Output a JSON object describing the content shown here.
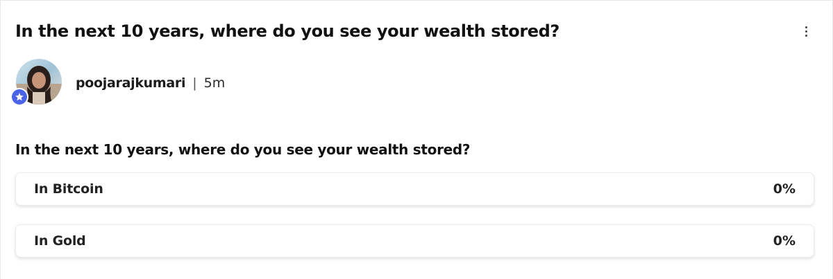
{
  "post": {
    "title": "In the next 10 years, where do you see your wealth stored?",
    "more_icon": "more-vertical-icon"
  },
  "author": {
    "username": "poojarajkumari",
    "separator": "|",
    "time": "5m",
    "badge_icon": "star-icon",
    "badge_color": "#4a63e7"
  },
  "poll": {
    "question": "In the next 10 years, where do you see your wealth stored?",
    "options": [
      {
        "label": "In Bitcoin",
        "percent": "0%"
      },
      {
        "label": "In Gold",
        "percent": "0%"
      }
    ]
  }
}
